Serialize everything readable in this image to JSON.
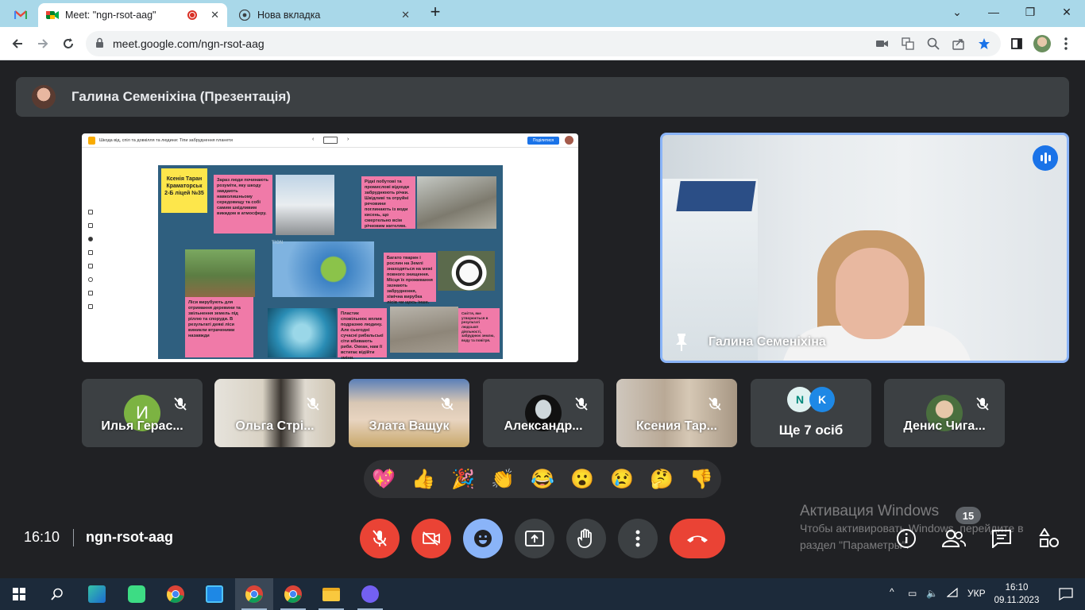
{
  "browser": {
    "tabs": [
      {
        "title": "Meet: \"ngn-rsot-aag\"",
        "active": true,
        "recording": true
      },
      {
        "title": "Нова вкладка",
        "active": false
      }
    ],
    "new_tab_symbol": "+",
    "address": "meet.google.com/ngn-rsot-aag"
  },
  "meet": {
    "presenter_bar": {
      "name": "Галина Семеніхіна (Презентація)"
    },
    "presentation": {
      "doc_title": "Шкода від, спіл та довкілля та людини: Тіпи забруднення планети",
      "share_label": "Поділитися",
      "note_author": "Ксенія Таран Краматорськ 2-Б ліцей №35",
      "notes": [
        "Зараз люди починають розуміти, яку шкоду завдають навколишньому середовищу та собі самим шкідливим викидом в атмосферу.",
        "Рідкі побутові та промислові відходи забруднюють річки. Шкідливі та отруйні речовини поглинають із води кисень, що смертельно всім річковим жителям.",
        "Багато тварин і рослин на Землі знаходяться на межі повного знищення. Місця їх проживання зазнають забруднення, хімічна вирубка лісів чи щось інше.",
        "Ліси вирубують для отримання деревини та звільнення земель під ріллю та споруди. В результаті деякі ліси виникли втраченими назавжди",
        "Пластик сповільнює вплив подразню людину. Але сьогодні сучасні рибальські сіти вбивають риби. Океан, нам її встигає відійти зміни.",
        "Сміття, яке утворюється в результаті людської діяльності, забруднює землю, воду та повітря."
      ],
      "watermark": "TION"
    },
    "speaker": {
      "name": "Галина Семеніхіна",
      "icon": "audio-wave-icon"
    },
    "participants": [
      {
        "name": "Илья Герас...",
        "initial": "И",
        "avatar_color": "#7cb342"
      },
      {
        "name": "Ольга Стрі..."
      },
      {
        "name": "Злата Ващук"
      },
      {
        "name": "Александр..."
      },
      {
        "name": "Ксения Тар..."
      },
      {
        "name": "Ще 7 осіб",
        "avatars": [
          "N",
          "K"
        ]
      },
      {
        "name": "Денис Чига..."
      }
    ],
    "reactions": [
      "💖",
      "👍",
      "🎉",
      "👏",
      "😂",
      "😮",
      "😢",
      "🤔",
      "👎"
    ],
    "time": "16:10",
    "meeting_code": "ngn-rsot-aag",
    "participant_count": "15",
    "colors": {
      "danger": "#ea4335",
      "accent": "#8ab4f8",
      "surface": "#3c4043",
      "background": "#202124"
    }
  },
  "watermark": {
    "title": "Активация Windows",
    "line1": "Чтобы активировать Windows, перейдите в",
    "line2": "раздел \"Параметры\"."
  },
  "taskbar": {
    "language": "УКР",
    "time": "16:10",
    "date": "09.11.2023"
  }
}
